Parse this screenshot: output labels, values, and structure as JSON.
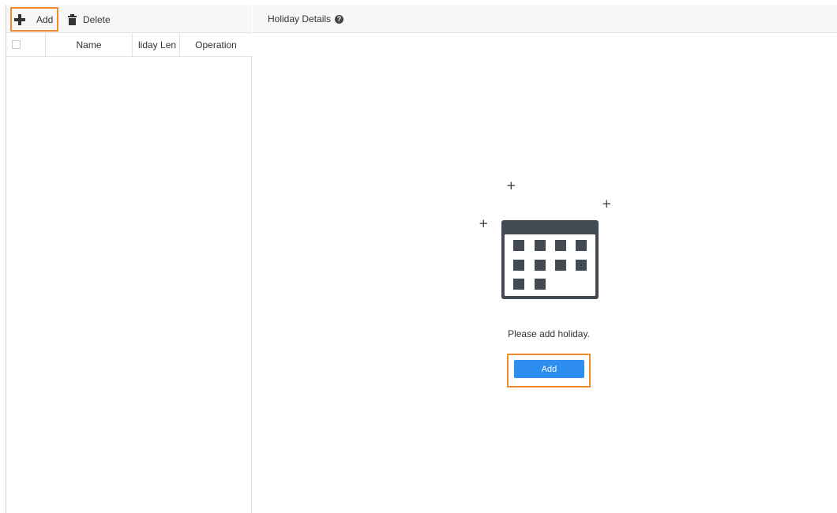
{
  "toolbar": {
    "add_label": "Add",
    "add_icon": "plus-icon",
    "delete_label": "Delete",
    "delete_icon": "trash-icon"
  },
  "table": {
    "columns": [
      "",
      "Name",
      "liday Len",
      "Operation"
    ],
    "rows": []
  },
  "details": {
    "title": "Holiday Details",
    "help_icon": "question-circle-icon",
    "help_glyph": "?",
    "empty_icon": "calendar-icon",
    "sparkle_glyph": "+",
    "empty_message": "Please add holiday.",
    "add_button_label": "Add"
  },
  "colors": {
    "highlight": "#f08a2c",
    "primary_button": "#2e8ef0",
    "icon_dark": "#434a51"
  }
}
